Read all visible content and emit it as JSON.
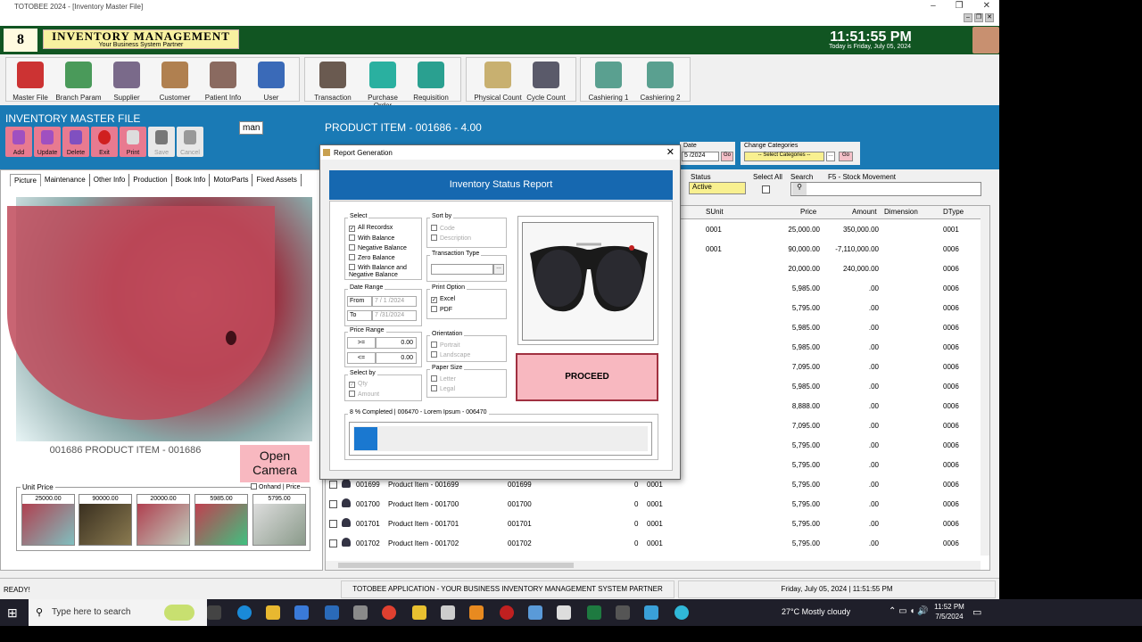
{
  "window": {
    "title": "TOTOBEE 2024 - [Inventory Master File]"
  },
  "banner": {
    "number": "8",
    "brand": "INVENTORY MANAGEMENT",
    "tagline": "Your Business System Partner",
    "clock": "11:51:55 PM",
    "today": "Today is Friday, July 05, 2024"
  },
  "toolbar": {
    "groups": [
      {
        "items": [
          "Master File",
          "Branch Param",
          "Supplier",
          "Customer",
          "Patient Info",
          "User"
        ]
      },
      {
        "items": [
          "Transaction",
          "Purchase Order",
          "Requisition"
        ]
      },
      {
        "items": [
          "Physical Count",
          "Cycle Count"
        ]
      },
      {
        "items": [
          "Cashiering 1",
          "Cashiering 2"
        ]
      }
    ]
  },
  "inventory": {
    "title": "INVENTORY  MASTER FILE",
    "search_tag": "man",
    "product_title": "PRODUCT ITEM - 001686 - 4.00",
    "crud": [
      "Add",
      "Update",
      "Delete",
      "Exit",
      "Print",
      "Save",
      "Cancel"
    ]
  },
  "filters": {
    "date_label": "Date",
    "date_value": "5 /2024",
    "change_categories_label": "Change Categories",
    "categories_placeholder": "-- Select Categories --",
    "go": "Go",
    "status_label": "Status",
    "status_value": "Active",
    "select_all": "Select All",
    "search_label": "Search",
    "stock_movement": "F5 - Stock Movement"
  },
  "left": {
    "tabs": [
      "Picture",
      "Maintenance",
      "Other Info",
      "Production",
      "Book Info",
      "MotorParts",
      "Fixed Assets"
    ],
    "caption": "001686 PRODUCT ITEM - 001686",
    "open_camera": "Open Camera",
    "unit_price_label": "Unit Price",
    "onhand_label": "Onhand | Price",
    "thumbnails": [
      "25000.00",
      "90000.00",
      "20000.00",
      "5985.00",
      "5795.00"
    ]
  },
  "grid": {
    "columns": [
      "SUnit",
      "Price",
      "Amount",
      "Dimension",
      "DType"
    ],
    "rows": [
      {
        "code": "",
        "name": "",
        "ref": "",
        "qty": "",
        "sunit": "0001",
        "price": "25,000.00",
        "amount": "350,000.00",
        "dtype": "0001"
      },
      {
        "code": "",
        "name": "",
        "ref": "",
        "qty": "",
        "sunit": "0001",
        "price": "90,000.00",
        "amount": "-7,110,000.00",
        "dtype": "0006"
      },
      {
        "code": "",
        "name": "",
        "ref": "",
        "qty": "",
        "sunit": "",
        "price": "20,000.00",
        "amount": "240,000.00",
        "dtype": "0006"
      },
      {
        "code": "",
        "name": "",
        "ref": "",
        "qty": "",
        "sunit": "",
        "price": "5,985.00",
        "amount": ".00",
        "dtype": "0006"
      },
      {
        "code": "",
        "name": "",
        "ref": "",
        "qty": "",
        "sunit": "",
        "price": "5,795.00",
        "amount": ".00",
        "dtype": "0006"
      },
      {
        "code": "",
        "name": "",
        "ref": "",
        "qty": "",
        "sunit": "",
        "price": "5,985.00",
        "amount": ".00",
        "dtype": "0006"
      },
      {
        "code": "",
        "name": "",
        "ref": "",
        "qty": "",
        "sunit": "",
        "price": "5,985.00",
        "amount": ".00",
        "dtype": "0006"
      },
      {
        "code": "",
        "name": "",
        "ref": "",
        "qty": "",
        "sunit": "",
        "price": "7,095.00",
        "amount": ".00",
        "dtype": "0006"
      },
      {
        "code": "",
        "name": "",
        "ref": "",
        "qty": "",
        "sunit": "",
        "price": "5,985.00",
        "amount": ".00",
        "dtype": "0006"
      },
      {
        "code": "",
        "name": "",
        "ref": "",
        "qty": "",
        "sunit": "",
        "price": "8,888.00",
        "amount": ".00",
        "dtype": "0006"
      },
      {
        "code": "",
        "name": "",
        "ref": "",
        "qty": "",
        "sunit": "",
        "price": "7,095.00",
        "amount": ".00",
        "dtype": "0006"
      },
      {
        "code": "",
        "name": "",
        "ref": "",
        "qty": "",
        "sunit": "",
        "price": "5,795.00",
        "amount": ".00",
        "dtype": "0006"
      },
      {
        "code": "",
        "name": "",
        "ref": "",
        "qty": "",
        "sunit": "",
        "price": "5,795.00",
        "amount": ".00",
        "dtype": "0006"
      },
      {
        "code": "001699",
        "name": "Product Item - 001699",
        "ref": "001699",
        "qty": "0",
        "sunit": "0001",
        "price": "5,795.00",
        "amount": ".00",
        "dtype": "0006"
      },
      {
        "code": "001700",
        "name": "Product Item - 001700",
        "ref": "001700",
        "qty": "0",
        "sunit": "0001",
        "price": "5,795.00",
        "amount": ".00",
        "dtype": "0006"
      },
      {
        "code": "001701",
        "name": "Product Item - 001701",
        "ref": "001701",
        "qty": "0",
        "sunit": "0001",
        "price": "5,795.00",
        "amount": ".00",
        "dtype": "0006"
      },
      {
        "code": "001702",
        "name": "Product Item - 001702",
        "ref": "001702",
        "qty": "0",
        "sunit": "0001",
        "price": "5,795.00",
        "amount": ".00",
        "dtype": "0006"
      }
    ]
  },
  "dialog": {
    "title": "Report Generation",
    "header": "Inventory Status Report",
    "select_label": "Select",
    "select_options": [
      "All Recordsx",
      "With Balance",
      "Negative Balance",
      "Zero Balance",
      "With Balance and Negative Balance"
    ],
    "sortby_label": "Sort by",
    "sortby_options": [
      "Code",
      "Description"
    ],
    "transaction_type_label": "Transaction Type",
    "date_range_label": "Date Range",
    "from_label": "From",
    "from_value": "7 / 1 /2024",
    "to_label": "To",
    "to_value": "7 /31/2024",
    "print_option_label": "Print Option",
    "print_options": [
      "Excel",
      "PDF"
    ],
    "price_range_label": "Price Range",
    "price_ge": ">=",
    "price_le": "<=",
    "price_ge_value": "0.00",
    "price_le_value": "0.00",
    "orientation_label": "Orientation",
    "orientation_options": [
      "Portrait",
      "Landscape"
    ],
    "selectby_label": "Select by",
    "selectby_options": [
      "Qty",
      "Amount"
    ],
    "paper_size_label": "Paper Size",
    "paper_options": [
      "Letter",
      "Legal"
    ],
    "proceed": "PROCEED",
    "progress_text": "8 % Completed  | 006470 - Lorem Ipsum - 006470",
    "progress_fraction": 0.08
  },
  "statusbar": {
    "left": "READY!",
    "center": "TOTOBEE APPLICATION - YOUR BUSINESS INVENTORY MANAGEMENT SYSTEM PARTNER",
    "right": "Friday, July 05, 2024   |   11:51:55 PM"
  },
  "taskbar": {
    "search_placeholder": "Type here to search",
    "weather": "27°C  Mostly cloudy",
    "time": "11:52 PM",
    "date": "7/5/2024"
  }
}
